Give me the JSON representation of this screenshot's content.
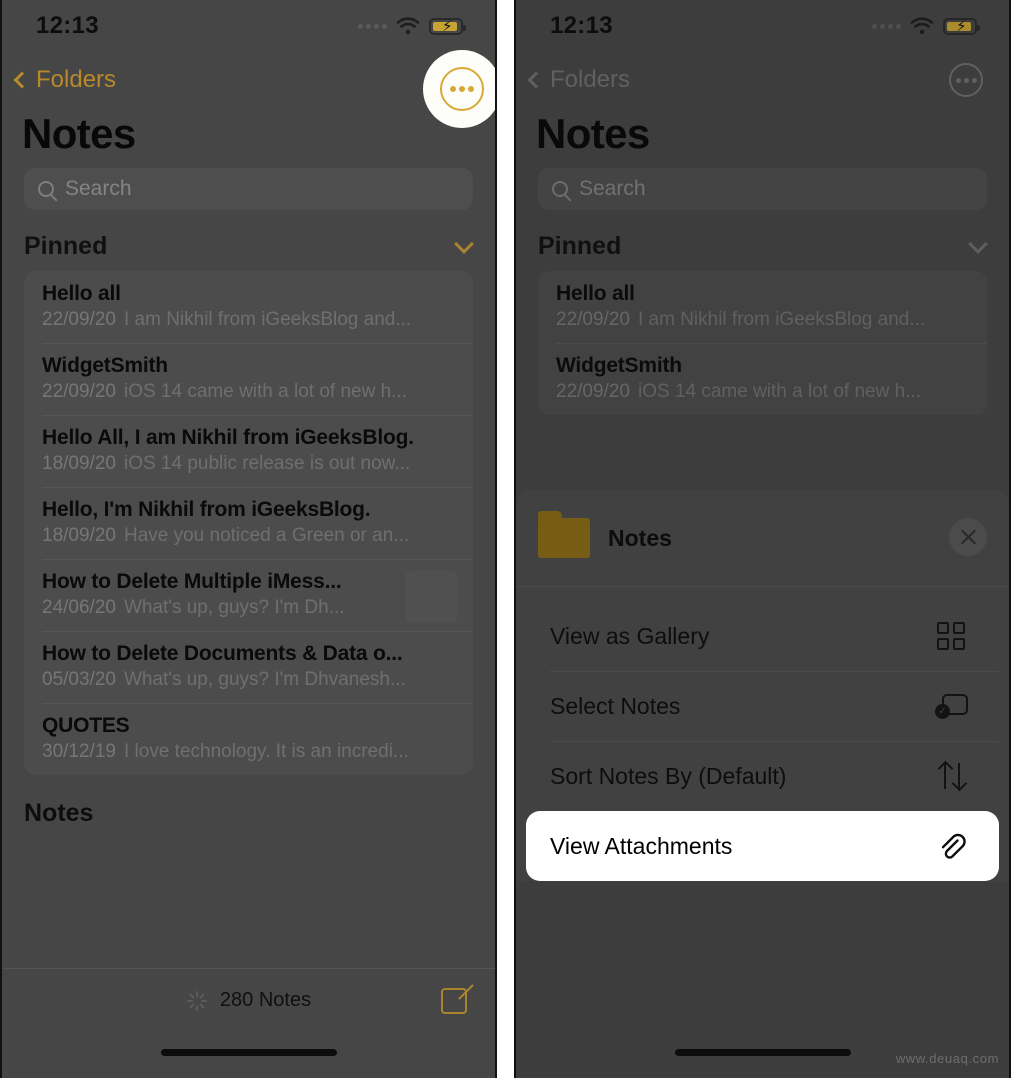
{
  "status_bar": {
    "time": "12:13",
    "wifi_icon": "wifi-icon",
    "battery_icon": "battery-charging-icon",
    "signal_icon": "signal-dots-icon"
  },
  "nav": {
    "back_label": "Folders",
    "back_icon": "chevron-left-icon",
    "more_icon": "ellipsis-circle-icon"
  },
  "page_title": "Notes",
  "search": {
    "placeholder": "Search",
    "icon": "search-icon"
  },
  "pinned_section": {
    "title": "Pinned",
    "collapse_icon": "chevron-down-icon",
    "notes": [
      {
        "title": "Hello all",
        "date": "22/09/20",
        "preview": "I am Nikhil from iGeeksBlog and...",
        "thumbnail": false
      },
      {
        "title": "WidgetSmith",
        "date": "22/09/20",
        "preview": "iOS 14 came with a lot of new h...",
        "thumbnail": false
      },
      {
        "title": "Hello All, I am Nikhil from iGeeksBlog.",
        "date": "18/09/20",
        "preview": "iOS 14 public release is out now...",
        "thumbnail": false
      },
      {
        "title": "Hello, I'm Nikhil from iGeeksBlog.",
        "date": "18/09/20",
        "preview": "Have you noticed a Green or an...",
        "thumbnail": false
      },
      {
        "title": "How to Delete Multiple iMess...",
        "date": "24/06/20",
        "preview": "What's up, guys? I'm Dh...",
        "thumbnail": true
      },
      {
        "title": "How to Delete Documents & Data o...",
        "date": "05/03/20",
        "preview": "What's up, guys? I'm Dhvanesh...",
        "thumbnail": false
      },
      {
        "title": "QUOTES",
        "date": "30/12/19",
        "preview": "I love technology. It is an incredi...",
        "thumbnail": false
      }
    ]
  },
  "notes_section": {
    "title": "Notes"
  },
  "toolbar": {
    "count_label": "280 Notes",
    "sync_icon": "sync-spinner-icon",
    "compose_icon": "compose-icon"
  },
  "action_sheet": {
    "folder_icon": "folder-icon",
    "folder_name": "Notes",
    "close_icon": "close-icon",
    "items": [
      {
        "label": "View as Gallery",
        "icon": "gallery-grid-icon",
        "highlighted": false
      },
      {
        "label": "Select Notes",
        "icon": "select-notes-icon",
        "highlighted": false
      },
      {
        "label": "Sort Notes By (Default)",
        "icon": "sort-arrows-icon",
        "highlighted": false
      },
      {
        "label": "View Attachments",
        "icon": "paperclip-icon",
        "highlighted": true
      }
    ]
  },
  "watermark": "www.deuaq.com",
  "colors": {
    "panel_background": "#464646",
    "card_background": "#4c4c4c",
    "accent_gold": "#b7892b",
    "highlight_white": "#ffffff",
    "folder_gold": "#8b6a14",
    "text_primary": "#0a0a0a",
    "text_secondary": "#6f6f6f"
  }
}
